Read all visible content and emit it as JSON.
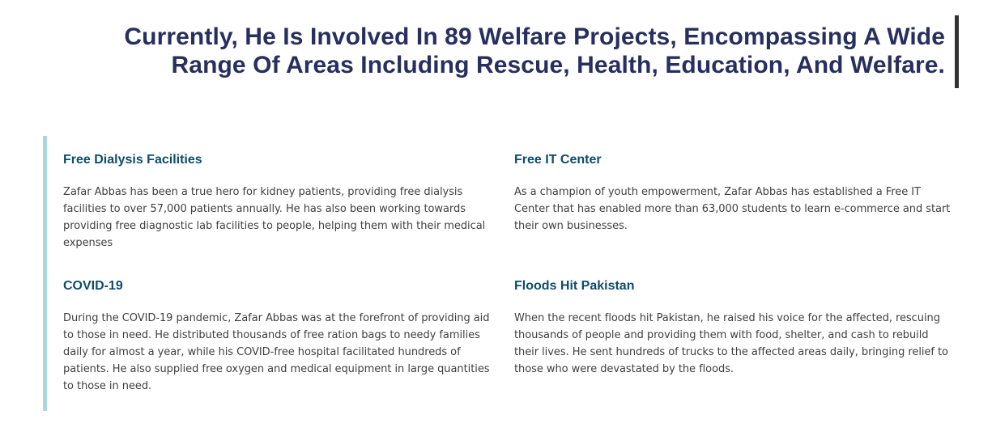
{
  "headline": {
    "line1": "Currently, He Is Involved In 89 Welfare Projects, Encompassing A Wide",
    "line2": "Range Of Areas Including Rescue, Health, Education, And Welfare."
  },
  "cards": [
    {
      "title": "Free Dialysis Facilities",
      "body": "Zafar Abbas has been a true hero for kidney patients, providing free dialysis facilities to over 57,000 patients annually. He has also been working towards providing free diagnostic lab facilities to people, helping them with their medical expenses"
    },
    {
      "title": "Free IT Center",
      "body": "As a champion of youth empowerment, Zafar Abbas has established a Free IT Center that has enabled more than 63,000 students to learn e-commerce and start their own businesses."
    },
    {
      "title": "COVID-19",
      "body": "During the COVID-19 pandemic, Zafar Abbas was at the forefront of providing aid to those in need. He distributed thousands of free ration bags to needy families daily for almost a year, while his COVID-free hospital facilitated hundreds of patients. He also supplied free oxygen and medical equipment in large quantities to those in need."
    },
    {
      "title": "Floods Hit Pakistan",
      "body": "When the recent floods hit Pakistan, he raised his voice for the affected, rescuing thousands of people and providing them with food, shelter, and cash to rebuild their lives. He sent hundreds of trucks to the affected areas daily, bringing relief to those who were devastated by the floods."
    }
  ],
  "colors": {
    "headline": "#272f5f",
    "card_title": "#0e4c6a",
    "body_text": "#404040",
    "accent_bar": "#a8d8df",
    "headline_bar": "#333333"
  }
}
